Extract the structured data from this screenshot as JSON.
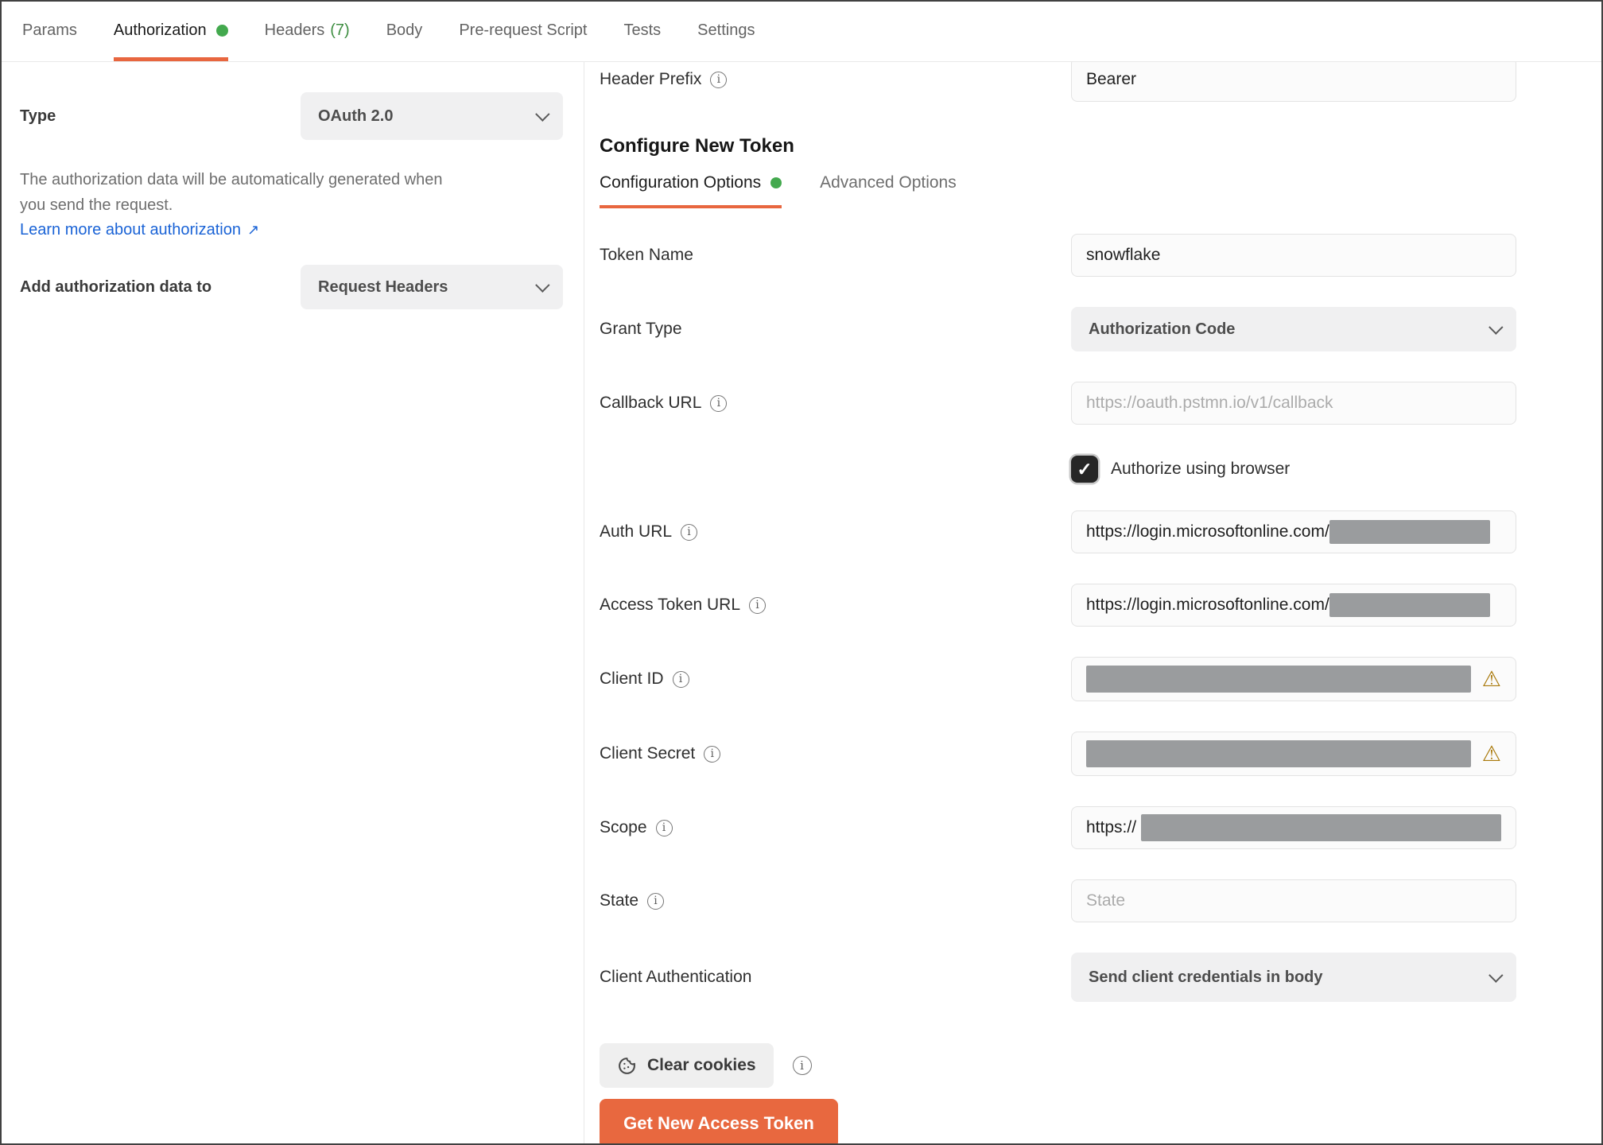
{
  "tabs": [
    {
      "label": "Params"
    },
    {
      "label": "Authorization",
      "active": true,
      "has_dot": true
    },
    {
      "label": "Headers",
      "count": "(7)"
    },
    {
      "label": "Body"
    },
    {
      "label": "Pre-request Script"
    },
    {
      "label": "Tests"
    },
    {
      "label": "Settings"
    }
  ],
  "left_panel": {
    "type_label": "Type",
    "type_value": "OAuth 2.0",
    "description": "The authorization data will be automatically generated when you send the request.",
    "learn_more_label": "Learn more about authorization",
    "add_auth_label": "Add authorization data to",
    "add_auth_value": "Request Headers"
  },
  "right_panel": {
    "header_prefix_label": "Header Prefix",
    "header_prefix_value": "Bearer",
    "section_title": "Configure New Token",
    "tabs": {
      "config": "Configuration Options",
      "advanced": "Advanced Options"
    },
    "token_name_label": "Token Name",
    "token_name_value": "snowflake",
    "grant_type_label": "Grant Type",
    "grant_type_value": "Authorization Code",
    "callback_url_label": "Callback URL",
    "callback_url_placeholder": "https://oauth.pstmn.io/v1/callback",
    "authorize_browser_label": "Authorize using browser",
    "authorize_browser_checked": true,
    "auth_url_label": "Auth URL",
    "auth_url_prefix": "https://login.microsoftonline.com/",
    "auth_url_redacted": true,
    "access_token_url_label": "Access Token URL",
    "access_token_url_prefix": "https://login.microsoftonline.com/",
    "access_token_url_redacted": true,
    "client_id_label": "Client ID",
    "client_id_redacted": true,
    "client_secret_label": "Client Secret",
    "client_secret_redacted": true,
    "scope_label": "Scope",
    "scope_prefix": "https://",
    "scope_redacted": true,
    "state_label": "State",
    "state_placeholder": "State",
    "client_auth_label": "Client Authentication",
    "client_auth_value": "Send client credentials in body",
    "clear_cookies_label": "Clear cookies",
    "get_token_label": "Get New Access Token"
  },
  "icons": {
    "info": "i",
    "check": "✓",
    "external_link": "↗",
    "warning": "⚠"
  },
  "colors": {
    "accent_orange": "#E8663F",
    "green_dot": "#43A94E",
    "green_count": "#3E8E41",
    "link_blue": "#1A63D6",
    "redaction_gray": "#9A9C9E",
    "warning_amber": "#A9790B"
  }
}
